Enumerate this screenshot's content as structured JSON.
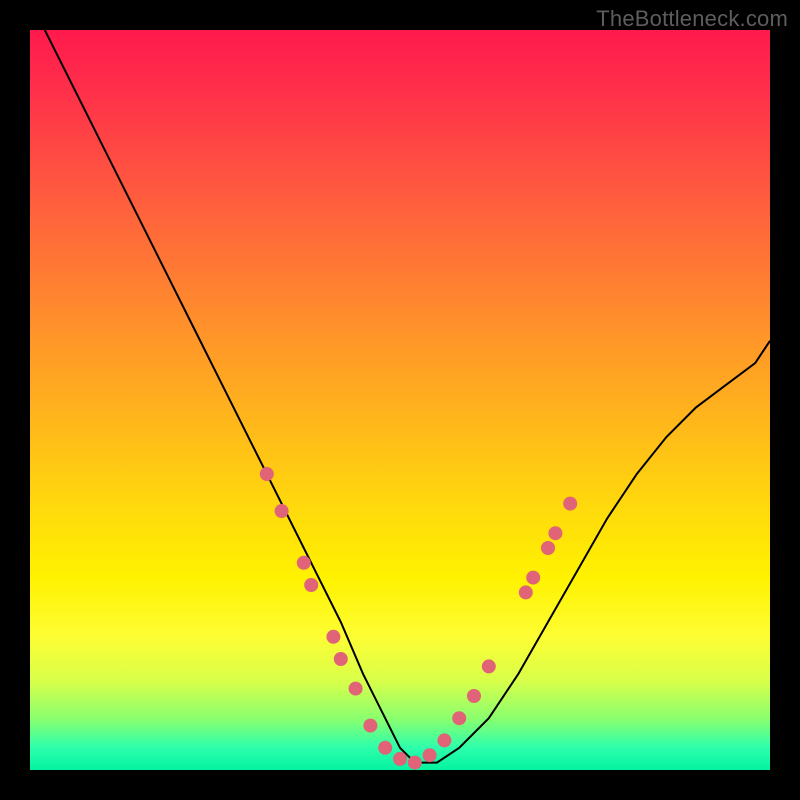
{
  "watermark": "TheBottleneck.com",
  "chart_data": {
    "type": "line",
    "title": "",
    "xlabel": "",
    "ylabel": "",
    "xlim": [
      0,
      100
    ],
    "ylim": [
      0,
      100
    ],
    "grid": false,
    "legend": false,
    "series": [
      {
        "name": "curve",
        "x": [
          2,
          6,
          10,
          14,
          18,
          22,
          26,
          30,
          34,
          38,
          42,
          45,
          48,
          50,
          52,
          55,
          58,
          62,
          66,
          70,
          74,
          78,
          82,
          86,
          90,
          94,
          98,
          100
        ],
        "y": [
          100,
          92,
          84,
          76,
          68,
          60,
          52,
          44,
          36,
          28,
          20,
          13,
          7,
          3,
          1,
          1,
          3,
          7,
          13,
          20,
          27,
          34,
          40,
          45,
          49,
          52,
          55,
          58
        ]
      }
    ],
    "markers": [
      {
        "x": 32,
        "y": 40
      },
      {
        "x": 34,
        "y": 35
      },
      {
        "x": 37,
        "y": 28
      },
      {
        "x": 38,
        "y": 25
      },
      {
        "x": 41,
        "y": 18
      },
      {
        "x": 42,
        "y": 15
      },
      {
        "x": 44,
        "y": 11
      },
      {
        "x": 46,
        "y": 6
      },
      {
        "x": 48,
        "y": 3
      },
      {
        "x": 50,
        "y": 1.5
      },
      {
        "x": 52,
        "y": 1
      },
      {
        "x": 54,
        "y": 2
      },
      {
        "x": 56,
        "y": 4
      },
      {
        "x": 58,
        "y": 7
      },
      {
        "x": 60,
        "y": 10
      },
      {
        "x": 62,
        "y": 14
      },
      {
        "x": 67,
        "y": 24
      },
      {
        "x": 68,
        "y": 26
      },
      {
        "x": 70,
        "y": 30
      },
      {
        "x": 71,
        "y": 32
      },
      {
        "x": 73,
        "y": 36
      }
    ],
    "marker_color": "#e06377",
    "curve_color": "#000000"
  }
}
